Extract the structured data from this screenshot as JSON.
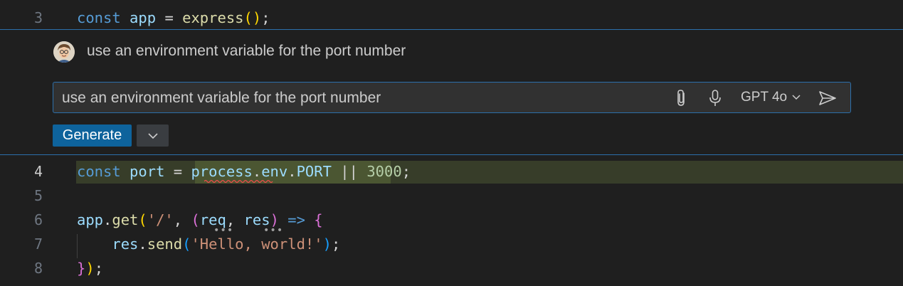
{
  "editor": {
    "lines": [
      {
        "number": "3",
        "tokens": [
          "const",
          " app ",
          "=",
          " express",
          "(",
          ")",
          ";"
        ]
      },
      {
        "number": "4",
        "tokens": [
          "const",
          " port ",
          "=",
          " ",
          "process",
          ".",
          "env",
          ".",
          "PORT",
          " || ",
          "3000",
          ";"
        ]
      },
      {
        "number": "5",
        "tokens": []
      },
      {
        "number": "6",
        "tokens": [
          "app",
          ".",
          "get",
          "(",
          "'/'",
          ", ",
          "(",
          "req",
          ", ",
          "res",
          ")",
          " => ",
          "{"
        ]
      },
      {
        "number": "7",
        "tokens": [
          "    res",
          ".",
          "send",
          "(",
          "'Hello, world!'",
          ")",
          ";"
        ]
      },
      {
        "number": "8",
        "tokens": [
          "}",
          ")",
          ";"
        ]
      }
    ]
  },
  "inline_chat": {
    "submitted_prompt": "use an environment variable for the port number",
    "input_value": "use an environment variable for the port number",
    "model_label": "GPT 4o",
    "generate_label": "Generate",
    "icons": {
      "attach": "paperclip-icon",
      "mic": "microphone-icon",
      "send": "send-icon",
      "model_dropdown": "chevron-down-icon",
      "generate_dropdown": "chevron-down-icon"
    }
  },
  "colors": {
    "accent_border": "#2c6fab",
    "generate_button": "#0e639c",
    "diff_line_highlight": "#373d29",
    "diff_word_highlight": "#4b5632"
  }
}
